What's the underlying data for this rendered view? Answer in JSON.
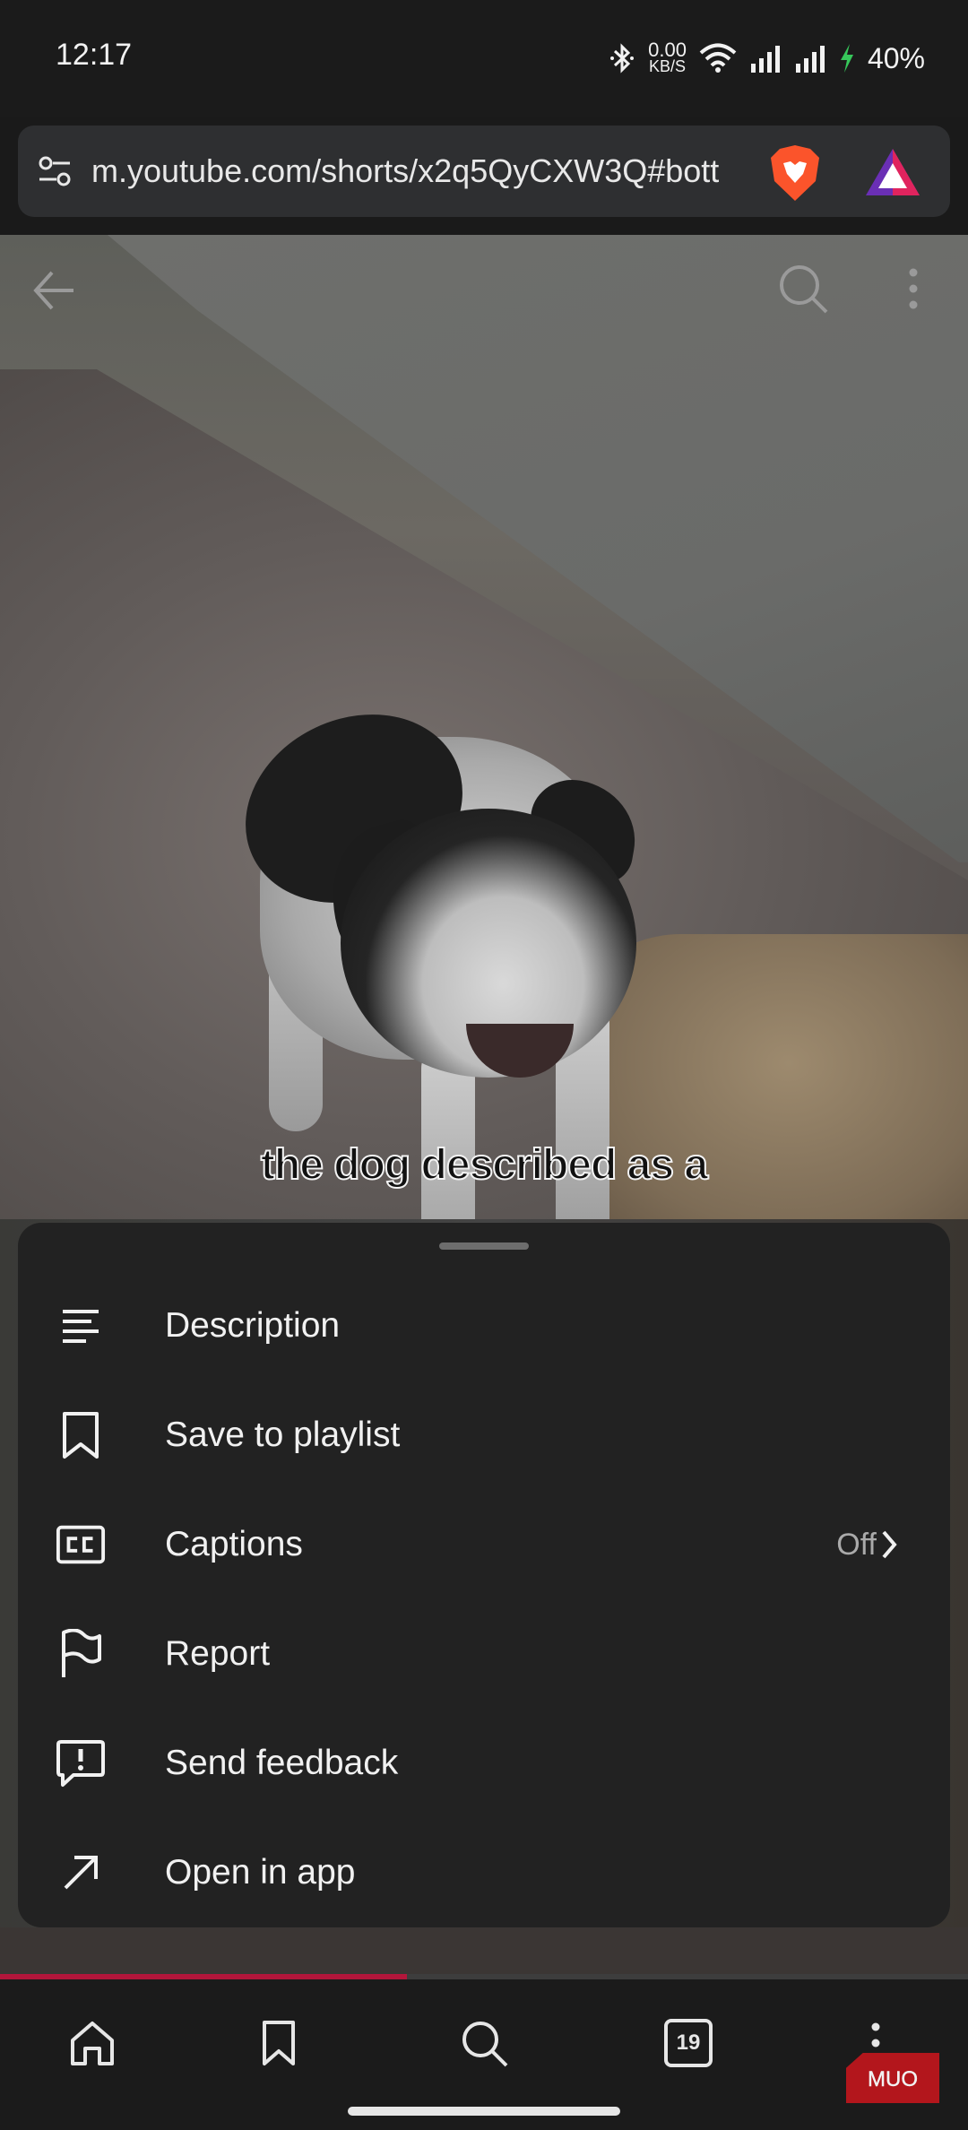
{
  "status_bar": {
    "time": "12:17",
    "net_speed_value": "0.00",
    "net_speed_unit": "KB/S",
    "battery": "40%"
  },
  "browser": {
    "url": "m.youtube.com/shorts/x2q5QyCXW3Q#bott"
  },
  "video": {
    "caption": "the dog described as a",
    "progress_percent": 42
  },
  "sheet": {
    "items": [
      {
        "label": "Description",
        "icon": "description-lines-icon"
      },
      {
        "label": "Save to playlist",
        "icon": "bookmark-icon"
      },
      {
        "label": "Captions",
        "icon": "cc-icon",
        "value": "Off"
      },
      {
        "label": "Report",
        "icon": "flag-icon"
      },
      {
        "label": "Send feedback",
        "icon": "feedback-icon"
      },
      {
        "label": "Open in app",
        "icon": "arrow-up-right-icon"
      }
    ]
  },
  "bottom_nav": {
    "tab_count": "19"
  },
  "watermark": {
    "text": "MUO"
  },
  "colors": {
    "accent_red": "#b3163b",
    "sheet_bg": "#222222",
    "brave_orange": "#fb542b"
  }
}
